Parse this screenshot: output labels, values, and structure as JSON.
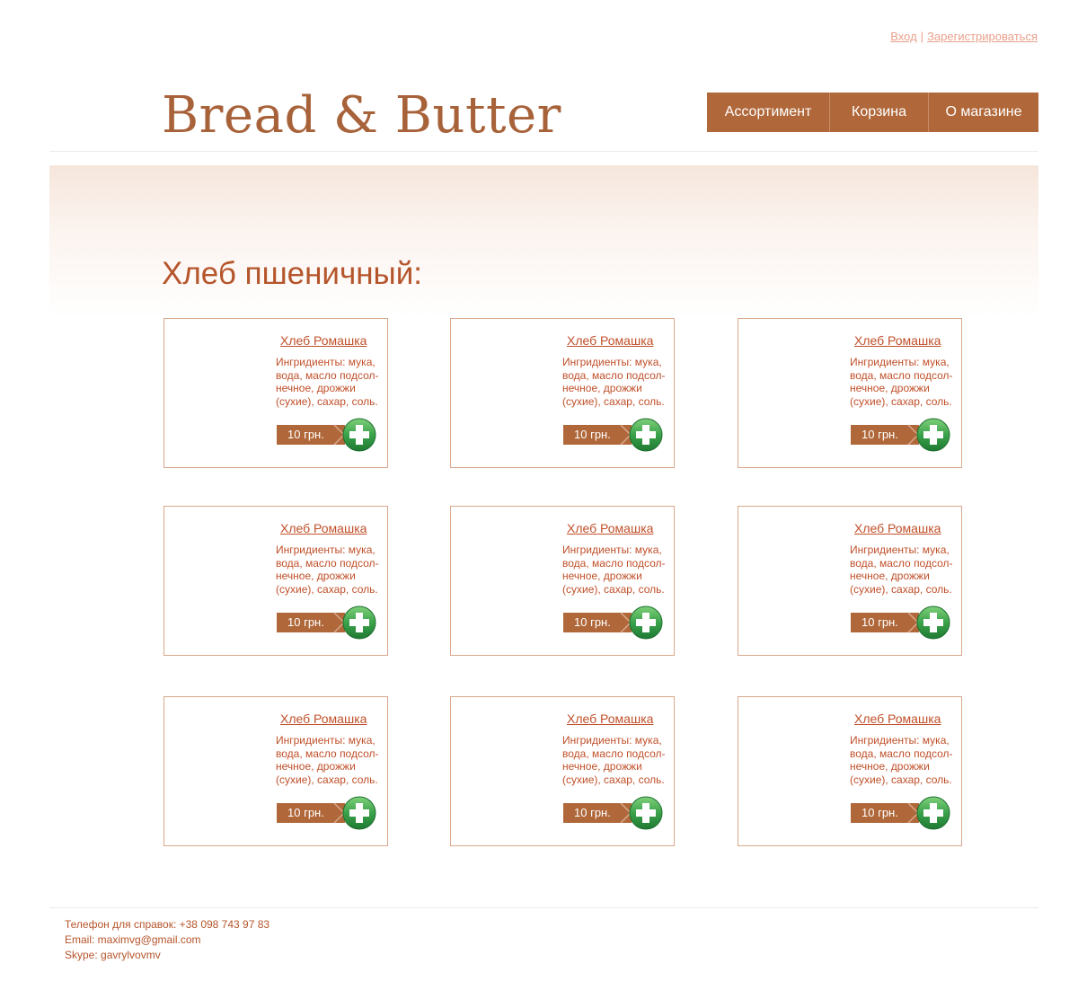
{
  "auth": {
    "login": "Вход",
    "separator": "|",
    "register": "Зарегистрироваться"
  },
  "header": {
    "logo": "Bread & Butter"
  },
  "nav": {
    "items": [
      "Ассортимент",
      "Корзина",
      "О магазине"
    ]
  },
  "section": {
    "title": "Хлеб пшеничный:"
  },
  "products": [
    {
      "name": "Хлеб Ромашка",
      "ingredients": [
        "Ингридиенты: мука,",
        "вода, масло подсол-",
        "нечное, дрожжи",
        "(сухие), сахар, соль."
      ],
      "price": "10 грн."
    },
    {
      "name": "Хлеб Ромашка",
      "ingredients": [
        "Ингридиенты: мука,",
        "вода, масло подсол-",
        "нечное, дрожжи",
        "(сухие), сахар, соль."
      ],
      "price": "10 грн."
    },
    {
      "name": "Хлеб Ромашка",
      "ingredients": [
        "Ингридиенты: мука,",
        "вода, масло подсол-",
        "нечное, дрожжи",
        "(сухие), сахар, соль."
      ],
      "price": "10 грн."
    },
    {
      "name": "Хлеб Ромашка",
      "ingredients": [
        "Ингридиенты: мука,",
        "вода, масло подсол-",
        "нечное, дрожжи",
        "(сухие), сахар, соль."
      ],
      "price": "10 грн."
    },
    {
      "name": "Хлеб Ромашка",
      "ingredients": [
        "Ингридиенты: мука,",
        "вода, масло подсол-",
        "нечное, дрожжи",
        "(сухие), сахар, соль."
      ],
      "price": "10 грн."
    },
    {
      "name": "Хлеб Ромашка",
      "ingredients": [
        "Ингридиенты: мука,",
        "вода, масло подсол-",
        "нечное, дрожжи",
        "(сухие), сахар, соль."
      ],
      "price": "10 грн."
    },
    {
      "name": "Хлеб Ромашка",
      "ingredients": [
        "Ингридиенты: мука,",
        "вода, масло подсол-",
        "нечное, дрожжи",
        "(сухие), сахар, соль."
      ],
      "price": "10 грн."
    },
    {
      "name": "Хлеб Ромашка",
      "ingredients": [
        "Ингридиенты: мука,",
        "вода, масло подсол-",
        "нечное, дрожжи",
        "(сухие), сахар, соль."
      ],
      "price": "10 грн."
    },
    {
      "name": "Хлеб Ромашка",
      "ingredients": [
        "Ингридиенты: мука,",
        "вода, масло подсол-",
        "нечное, дрожжи",
        "(сухие), сахар, соль."
      ],
      "price": "10 грн."
    }
  ],
  "footer": {
    "phone": "Телефон для справок: +38 098 743 97 83",
    "email": "Email: maximvg@gmail.com",
    "skype": "Skype: gavrylvovmv"
  },
  "colors": {
    "brand": "#b0683a",
    "text_accent": "#c0502a",
    "link_faded": "#eaa08c",
    "add_green": "#3aa24a"
  },
  "icons": {
    "add_to_cart": "plus-circle-icon",
    "price_arrow": "chevron-right-icon"
  }
}
